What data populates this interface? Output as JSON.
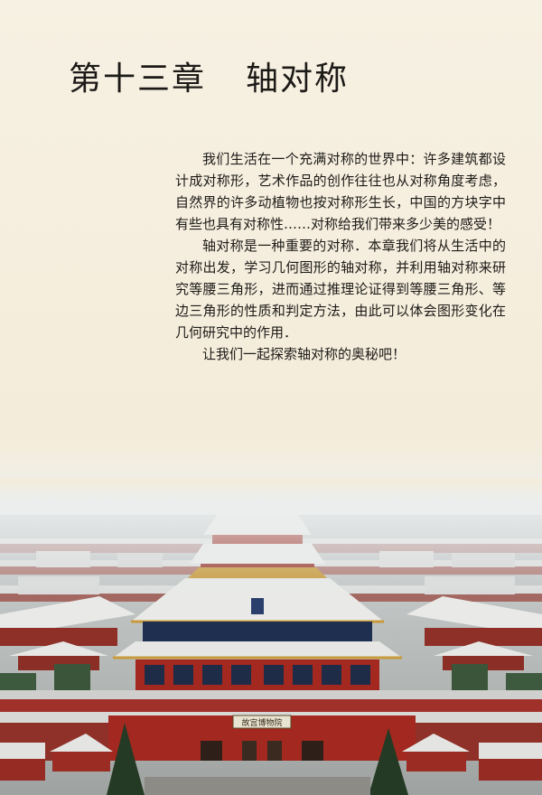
{
  "chapter": {
    "number_label": "第十三章",
    "title": "轴对称"
  },
  "intro": {
    "paragraphs": [
      "我们生活在一个充满对称的世界中：许多建筑都设计成对称形，艺术作品的创作往往也从对称角度考虑，自然界的许多动植物也按对称形生长，中国的方块字中有些也具有对称性……对称给我们带来多少美的感受！",
      "轴对称是一种重要的对称．本章我们将从生活中的对称出发，学习几何图形的轴对称，并利用轴对称来研究等腰三角形，进而通过推理论证得到等腰三角形、等边三角形的性质和判定方法，由此可以体会图形变化在几何研究中的作用．",
      "让我们一起探索轴对称的奥秘吧！"
    ]
  },
  "photo": {
    "plaque_text": "故宫博物院",
    "colors": {
      "wall_red": "#a3281f",
      "roof_snow": "#e9eae8",
      "eave_gold": "#c79a3b",
      "sky_mist": "#e6eaec"
    }
  }
}
